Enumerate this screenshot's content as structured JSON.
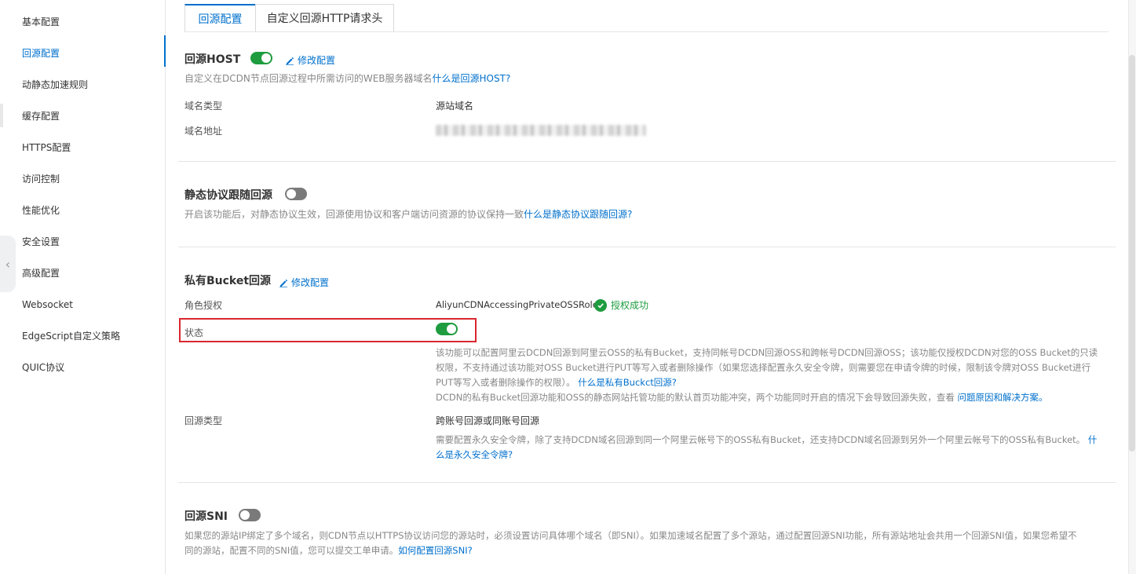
{
  "sidebar": {
    "items": [
      {
        "label": "基本配置"
      },
      {
        "label": "回源配置"
      },
      {
        "label": "动静态加速规则"
      },
      {
        "label": "缓存配置"
      },
      {
        "label": "HTTPS配置"
      },
      {
        "label": "访问控制"
      },
      {
        "label": "性能优化"
      },
      {
        "label": "安全设置"
      },
      {
        "label": "高级配置"
      },
      {
        "label": "Websocket"
      },
      {
        "label": "EdgeScript自定义策略"
      },
      {
        "label": "QUIC协议"
      }
    ],
    "active_index": 1,
    "collapse_icon": "chevron-left-icon"
  },
  "tabs": [
    {
      "label": "回源配置",
      "active": true
    },
    {
      "label": "自定义回源HTTP请求头",
      "active": false
    }
  ],
  "host": {
    "title": "回源HOST",
    "enabled": true,
    "edit_label": "修改配置",
    "desc": "自定义在DCDN节点回源过程中所需访问的WEB服务器域名",
    "desc_link": "什么是回源HOST?",
    "type_label": "域名类型",
    "type_value": "源站域名",
    "address_label": "域名地址"
  },
  "static_protocol": {
    "title": "静态协议跟随回源",
    "enabled": false,
    "desc": "开启该功能后，对静态协议生效，回源使用协议和客户端访问资源的协议保持一致",
    "desc_link": "什么是静态协议跟随回源?"
  },
  "bucket": {
    "title": "私有Bucket回源",
    "edit_label": "修改配置",
    "role_label": "角色授权",
    "role_value": "AliyunCDNAccessingPrivateOSSRole",
    "auth_status": "授权成功",
    "status_label": "状态",
    "status_enabled": true,
    "info_line1": "该功能可以配置阿里云DCDN回源到阿里云OSS的私有Bucket，支持同帐号DCDN回源OSS和跨帐号DCDN回源OSS；该功能仅授权DCDN对您的OSS Bucket的只读",
    "info_line2": "权限，不支持通过该功能对OSS Bucket进行PUT等写入或者删除操作（如果您选择配置永久安全令牌，则需要您在申请令牌的时候，限制该令牌对OSS Bucket进行",
    "info_line3": "PUT等写入或者删除操作的权限）。",
    "info_link1": "什么是私有Buckct回源?",
    "info_line4": "DCDN的私有Bucket回源功能和OSS的静态网站托管功能的默认首页功能冲突，两个功能同时开启的情况下会导致回源失败，查看",
    "info_link2": "问题原因和解决方案。",
    "type_label": "回源类型",
    "type_value": "跨账号回源或同账号回源",
    "type_desc_line1": "需要配置永久安全令牌，除了支持DCDN域名回源到同一个阿里云帐号下的OSS私有Bucket，还支持DCDN域名回源到另外一个阿里云帐号下的OSS私有Bucket。",
    "type_desc_link_a": "什",
    "type_desc_link_b": "么是永久安全令牌?"
  },
  "sni": {
    "title": "回源SNI",
    "enabled": false,
    "desc_line1": "如果您的源站IP绑定了多个域名，则CDN节点以HTTPS协议访问您的源站时，必须设置访问具体哪个域名（即SNI）。如果加速域名配置了多个源站，通过配置回源SNI功能，所有源站地址会共用一个回源SNI值，如果您希望不",
    "desc_line2": "同的源站，配置不同的SNI值，您可以提交工单申请。",
    "desc_link": "如何配置回源SNI?"
  },
  "colors": {
    "accent": "#0070cc",
    "toggle_on": "#1e9c3f",
    "toggle_off": "#7a7a7a",
    "highlight": "#d9272e"
  }
}
